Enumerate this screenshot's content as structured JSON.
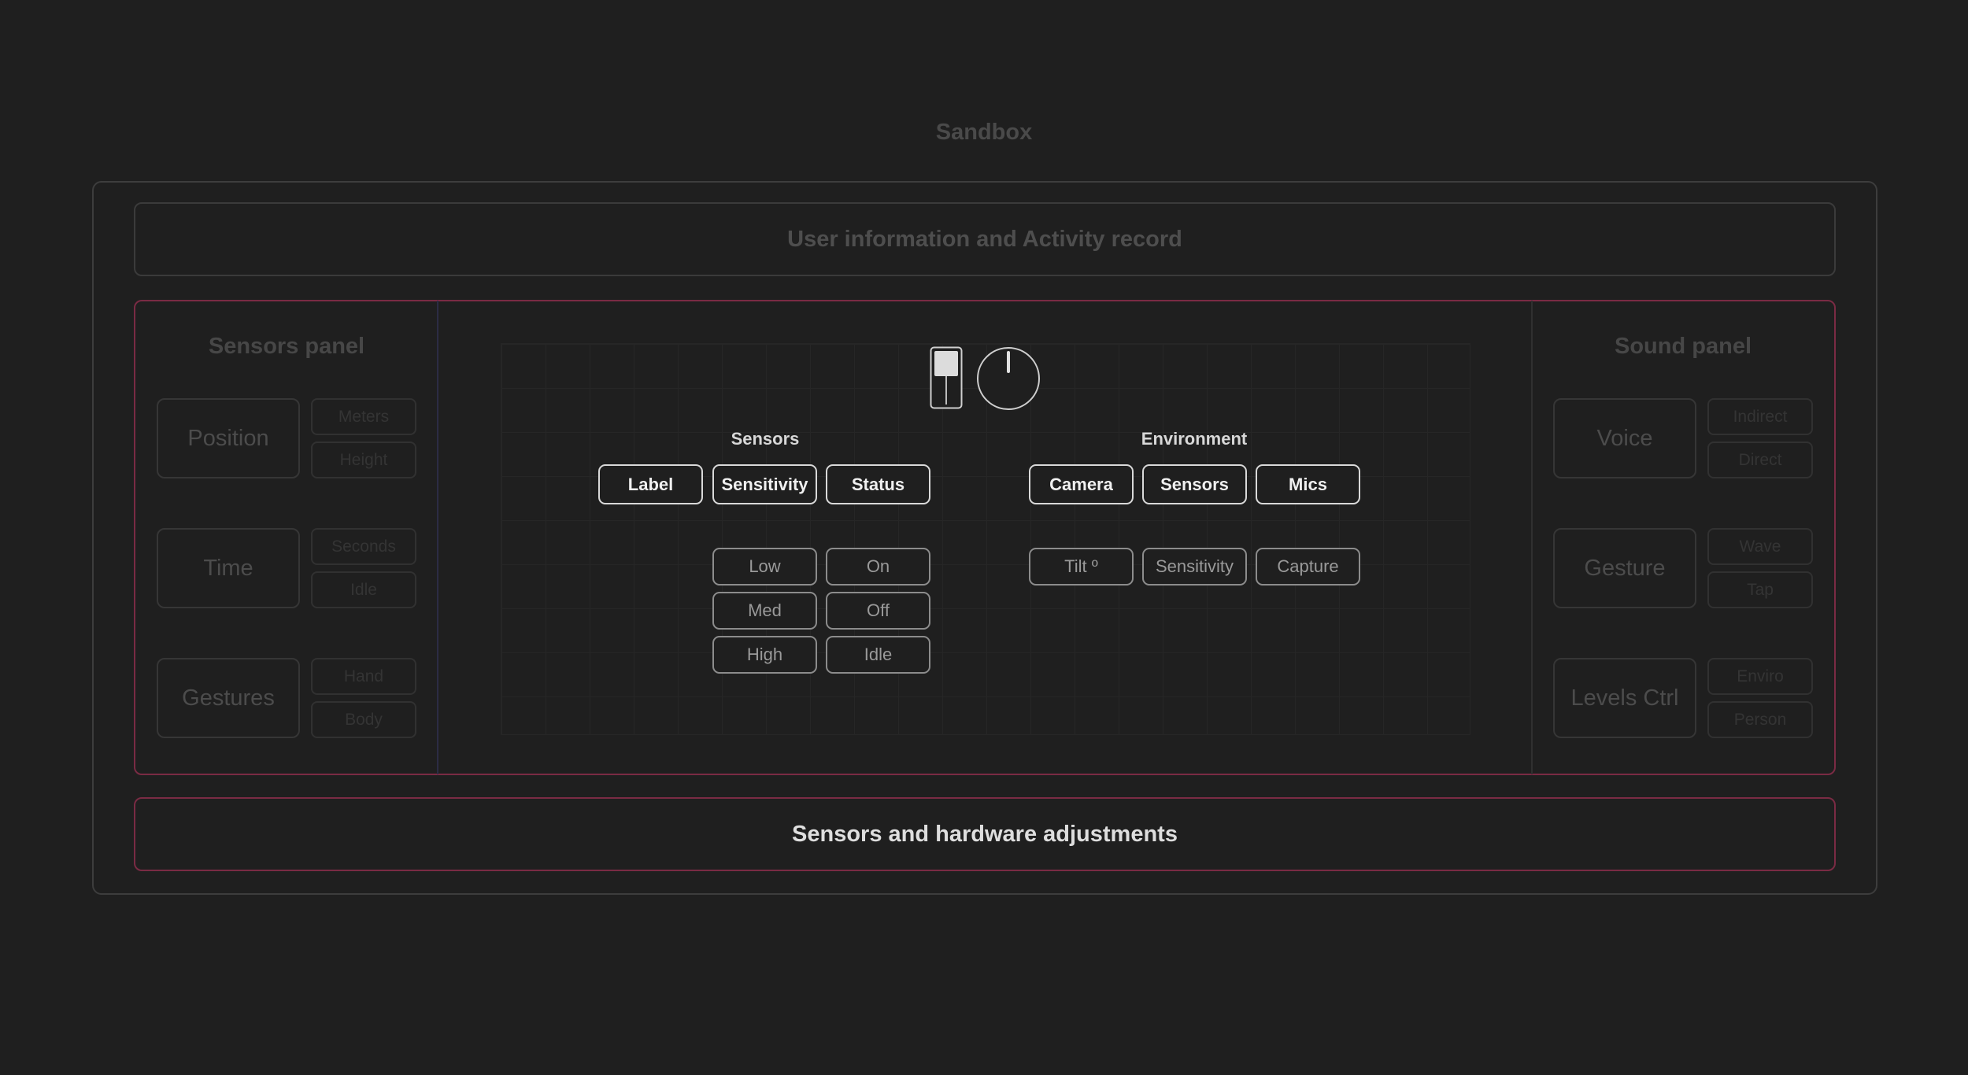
{
  "page": {
    "title": "Sandbox"
  },
  "top_bar": {
    "label": "User information and Activity record"
  },
  "bottom_bar": {
    "label": "Sensors and hardware adjustments"
  },
  "sensors_panel": {
    "title": "Sensors panel",
    "rows": [
      {
        "label": "Position",
        "options": [
          "Meters",
          "Height"
        ]
      },
      {
        "label": "Time",
        "options": [
          "Seconds",
          "Idle"
        ]
      },
      {
        "label": "Gestures",
        "options": [
          "Hand",
          "Body"
        ]
      }
    ]
  },
  "sound_panel": {
    "title": "Sound panel",
    "rows": [
      {
        "label": "Voice",
        "options": [
          "Indirect",
          "Direct"
        ]
      },
      {
        "label": "Gesture",
        "options": [
          "Wave",
          "Tap"
        ]
      },
      {
        "label": "Levels Ctrl",
        "options": [
          "Enviro",
          "Person"
        ]
      }
    ]
  },
  "controls": {
    "slider_level": 0.5,
    "knob_angle_deg": 0
  },
  "sensors_group": {
    "label": "Sensors",
    "headers": [
      "Label",
      "Sensitivity",
      "Status"
    ],
    "sensitivity_options": [
      "Low",
      "Med",
      "High"
    ],
    "status_options": [
      "On",
      "Off",
      "Idle"
    ]
  },
  "environment_group": {
    "label": "Environment",
    "headers": [
      "Camera",
      "Sensors",
      "Mics"
    ],
    "options": [
      "Tilt º",
      "Sensitivity",
      "Capture"
    ]
  },
  "colors": {
    "background": "#1f1f1f",
    "accent_border": "#7a2b44"
  }
}
